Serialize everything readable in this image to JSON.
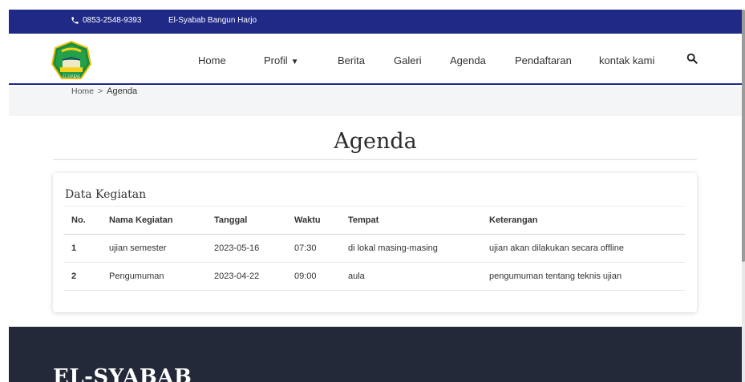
{
  "topbar": {
    "phone": "0853-2548-9393",
    "school_name": "El-Syabab Bangun Harjo",
    "background": "#1f2a87"
  },
  "navbar": {
    "items": [
      {
        "label": "Home"
      },
      {
        "label": "Profil"
      },
      {
        "label": "Berita"
      },
      {
        "label": "Galeri"
      },
      {
        "label": "Agenda"
      },
      {
        "label": "Pendaftaran"
      },
      {
        "label": "kontak kami"
      }
    ],
    "search_icon": "search-icon"
  },
  "breadcrumb": {
    "home": "Home",
    "separator": ">",
    "current": "Agenda"
  },
  "page": {
    "title": "Agenda"
  },
  "card": {
    "title": "Data Kegiatan",
    "columns": [
      "No.",
      "Nama Kegiatan",
      "Tanggal",
      "Waktu",
      "Tempat",
      "Keterangan"
    ],
    "rows": [
      {
        "no": "1",
        "nama": "ujian semester",
        "tanggal": "2023-05-16",
        "waktu": "07:30",
        "tempat": "di lokal masing-masing",
        "keterangan": "ujian akan dilakukan secara offline"
      },
      {
        "no": "2",
        "nama": "Pengumuman",
        "tanggal": "2023-04-22",
        "waktu": "09:00",
        "tempat": "aula",
        "keterangan": "pengumuman tentang teknis ujian"
      }
    ]
  },
  "footer": {
    "brand": "EL-SYABAB",
    "background": "#232938"
  }
}
